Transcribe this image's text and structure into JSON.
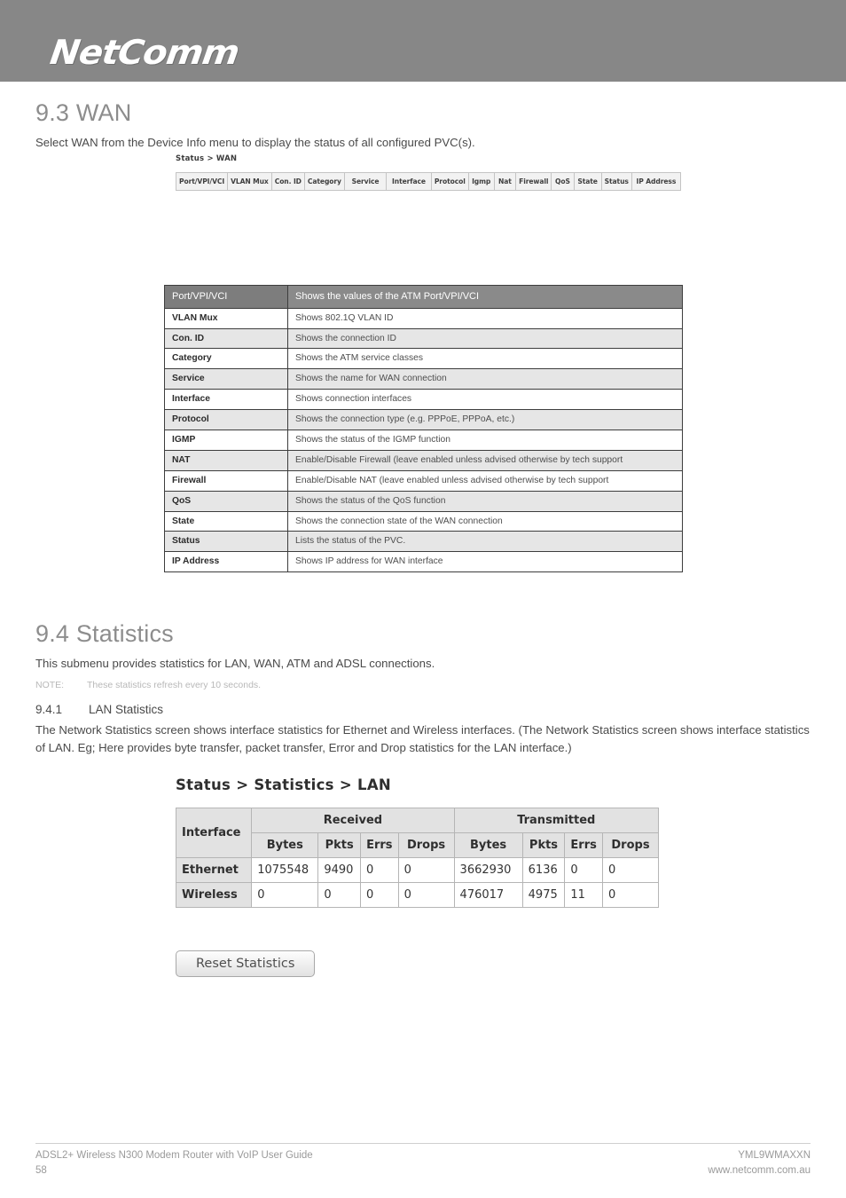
{
  "brand": {
    "logo_text": "NetComm"
  },
  "sections": {
    "wan": {
      "title": "9.3 WAN",
      "intro": "Select WAN from the Device Info menu to display the status of all configured PVC(s)."
    },
    "statistics": {
      "title": "9.4 Statistics",
      "intro": "This submenu provides statistics for LAN, WAN, ATM and ADSL connections.",
      "note_label": "NOTE:",
      "note_text": "These statistics refresh every 10 seconds.",
      "subsection_number": "9.4.1",
      "subsection_title": "LAN Statistics",
      "paragraph": "The Network Statistics screen shows interface statistics for Ethernet and Wireless interfaces. (The Network Statistics screen shows interface statistics of LAN. Eg; Here provides byte transfer, packet transfer, Error and Drop statistics for the LAN interface.)"
    }
  },
  "wan_screenshot": {
    "breadcrumb": "Status > WAN",
    "columns": [
      "Port/VPI/VCI",
      "VLAN Mux",
      "Con. ID",
      "Category",
      "Service",
      "Interface",
      "Protocol",
      "Igmp",
      "Nat",
      "Firewall",
      "QoS",
      "State",
      "Status",
      "IP Address"
    ]
  },
  "wan_table": {
    "header": {
      "field": "Port/VPI/VCI",
      "description": "Shows the values of the ATM Port/VPI/VCI"
    },
    "rows": [
      {
        "field": "VLAN Mux",
        "description": "Shows 802.1Q VLAN ID"
      },
      {
        "field": "Con. ID",
        "description": "Shows the connection ID"
      },
      {
        "field": "Category",
        "description": "Shows the ATM service classes"
      },
      {
        "field": "Service",
        "description": "Shows the name for WAN connection"
      },
      {
        "field": "Interface",
        "description": "Shows connection interfaces"
      },
      {
        "field": "Protocol",
        "description": "Shows the connection type (e.g. PPPoE, PPPoA, etc.)"
      },
      {
        "field": "IGMP",
        "description": "Shows the status of the IGMP function"
      },
      {
        "field": "NAT",
        "description": "Enable/Disable Firewall (leave enabled unless advised otherwise by tech support"
      },
      {
        "field": "Firewall",
        "description": "Enable/Disable NAT (leave enabled unless advised otherwise by tech support"
      },
      {
        "field": "QoS",
        "description": "Shows the status of the QoS function"
      },
      {
        "field": "State",
        "description": "Shows the connection state of the WAN connection"
      },
      {
        "field": "Status",
        "description": "Lists the status of the PVC."
      },
      {
        "field": "IP Address",
        "description": "Shows IP address for WAN interface"
      }
    ]
  },
  "lan_screenshot": {
    "breadcrumb": "Status > Statistics > LAN",
    "group_headers": {
      "interface": "Interface",
      "received": "Received",
      "transmitted": "Transmitted"
    },
    "sub_headers": {
      "rx_bytes": "Bytes",
      "rx_pkts": "Pkts",
      "rx_errs": "Errs",
      "rx_drops": "Drops",
      "tx_bytes": "Bytes",
      "tx_pkts": "Pkts",
      "tx_errs": "Errs",
      "tx_drops": "Drops"
    },
    "rows": [
      {
        "interface": "Ethernet",
        "rx_bytes": "1075548",
        "rx_pkts": "9490",
        "rx_errs": "0",
        "rx_drops": "0",
        "tx_bytes": "3662930",
        "tx_pkts": "6136",
        "tx_errs": "0",
        "tx_drops": "0"
      },
      {
        "interface": "Wireless",
        "rx_bytes": "0",
        "rx_pkts": "0",
        "rx_errs": "0",
        "rx_drops": "0",
        "tx_bytes": "476017",
        "tx_pkts": "4975",
        "tx_errs": "11",
        "tx_drops": "0"
      }
    ],
    "reset_button": "Reset Statistics"
  },
  "footer": {
    "guide_title": "ADSL2+ Wireless N300 Modem Router with VoIP User Guide",
    "page_number": "58",
    "model_code": "YML9WMAXXN",
    "website": "www.netcomm.com.au"
  },
  "colors": {
    "brand_bar": "#878787",
    "table_header": "#8a8a8a",
    "alt_row": "#e6e6e6",
    "heading_gray": "#8d8d8d"
  }
}
